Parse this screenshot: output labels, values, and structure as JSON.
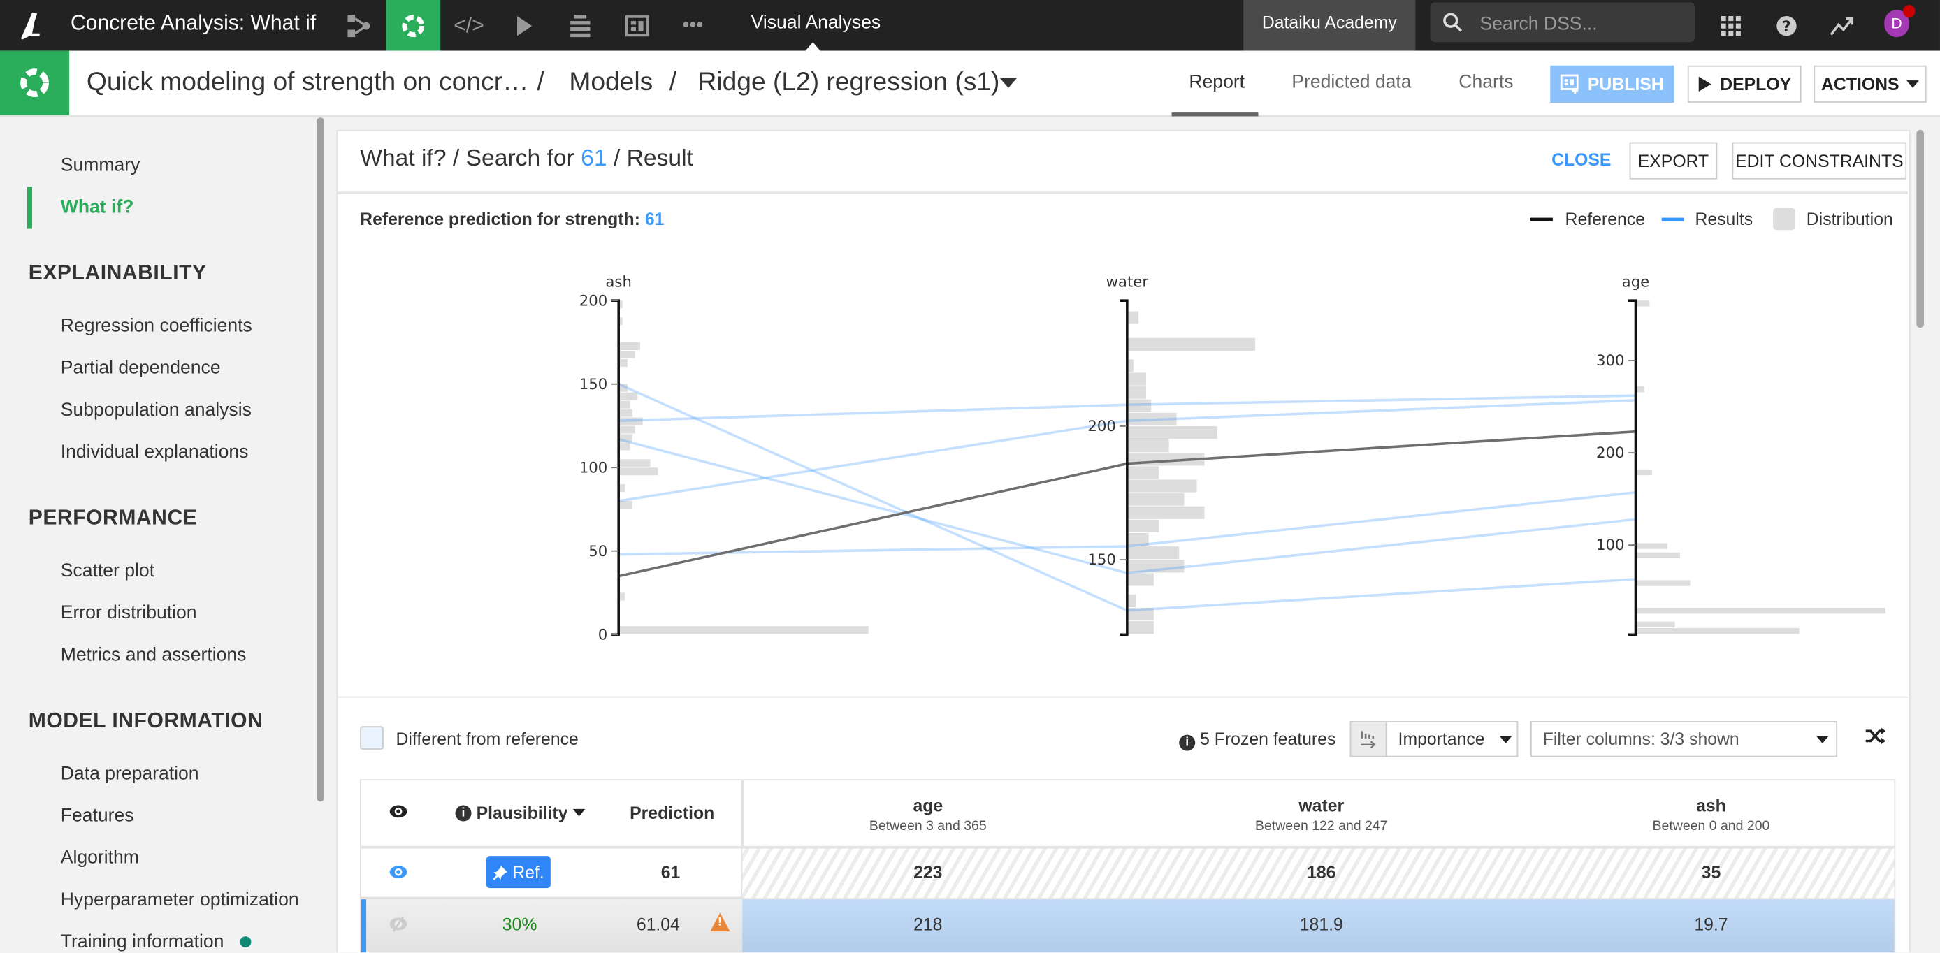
{
  "topbar": {
    "project_title": "Concrete Analysis: What if",
    "section_label": "Visual Analyses",
    "org_label": "Dataiku Academy",
    "search_placeholder": "Search DSS...",
    "avatar_initial": "D",
    "nav_icons": [
      "flow-icon",
      "lab-icon",
      "code-icon",
      "run-icon",
      "deployer-icon",
      "dashboard-icon",
      "more-icon"
    ],
    "accent": "#2aae5b"
  },
  "header": {
    "crumb_analysis": "Quick modeling of strength on concr…",
    "crumb_models": "Models",
    "crumb_model": "Ridge (L2) regression (s1)",
    "separator": "/",
    "tabs": [
      {
        "label": "Report",
        "active": true
      },
      {
        "label": "Predicted data",
        "active": false
      },
      {
        "label": "Charts",
        "active": false
      }
    ],
    "publish_label": "PUBLISH",
    "deploy_label": "DEPLOY",
    "actions_label": "ACTIONS"
  },
  "sidebar": {
    "top_items": [
      {
        "label": "Summary",
        "active": false
      },
      {
        "label": "What if?",
        "active": true
      }
    ],
    "sections": [
      {
        "title": "EXPLAINABILITY",
        "items": [
          "Regression coefficients",
          "Partial dependence",
          "Subpopulation analysis",
          "Individual explanations"
        ]
      },
      {
        "title": "PERFORMANCE",
        "items": [
          "Scatter plot",
          "Error distribution",
          "Metrics and assertions"
        ]
      },
      {
        "title": "MODEL INFORMATION",
        "items": [
          "Data preparation",
          "Features",
          "Algorithm",
          "Hyperparameter optimization",
          "Training information"
        ]
      }
    ]
  },
  "panel": {
    "title_prefix": "What if? / Search for ",
    "target_value": "61",
    "title_suffix": " / Result",
    "close_label": "CLOSE",
    "export_label": "EXPORT",
    "edit_constraints_label": "EDIT CONSTRAINTS",
    "ref_prediction_label": "Reference prediction for strength: ",
    "ref_prediction_value": "61"
  },
  "chart_data": {
    "type": "parallel-coordinates",
    "legend": [
      {
        "label": "Reference",
        "color": "#111111"
      },
      {
        "label": "Results",
        "color": "#3b99fc"
      },
      {
        "label": "Distribution",
        "color": "#dddddd"
      }
    ],
    "legend_position": "top-right",
    "axes": [
      {
        "name": "ash",
        "range": [
          0,
          200
        ],
        "ticks": [
          0,
          50,
          100,
          150,
          200
        ]
      },
      {
        "name": "water",
        "range": [
          122,
          247
        ],
        "ticks": [
          150,
          200
        ]
      },
      {
        "name": "age",
        "range": [
          3,
          365
        ],
        "ticks": [
          100,
          200,
          300
        ]
      }
    ],
    "reference": {
      "ash": 35,
      "water": 186,
      "age": 223
    },
    "results": [
      {
        "ash": 150,
        "water": 131,
        "age": 63
      },
      {
        "ash": 128,
        "water": 208,
        "age": 262
      },
      {
        "ash": 117,
        "water": 145,
        "age": 128
      },
      {
        "ash": 80,
        "water": 202,
        "age": 257
      },
      {
        "ash": 48,
        "water": 155,
        "age": 157
      }
    ],
    "distributions": {
      "ash": [
        [
          0,
          5,
          0.98
        ],
        [
          20,
          25,
          0.02
        ],
        [
          75,
          80,
          0.05
        ],
        [
          85,
          90,
          0.02
        ],
        [
          95,
          100,
          0.15
        ],
        [
          100,
          105,
          0.12
        ],
        [
          110,
          115,
          0.04
        ],
        [
          115,
          120,
          0.05
        ],
        [
          120,
          125,
          0.06
        ],
        [
          125,
          130,
          0.09
        ],
        [
          130,
          135,
          0.05
        ],
        [
          135,
          140,
          0.04
        ],
        [
          140,
          145,
          0.07
        ],
        [
          145,
          150,
          0.03
        ],
        [
          160,
          165,
          0.03
        ],
        [
          165,
          170,
          0.06
        ],
        [
          170,
          175,
          0.08
        ],
        [
          185,
          190,
          0.01
        ],
        [
          195,
          200,
          0.01
        ]
      ],
      "water": [
        [
          122,
          127,
          0.1
        ],
        [
          127,
          132,
          0.1
        ],
        [
          132,
          137,
          0.03
        ],
        [
          140,
          145,
          0.1
        ],
        [
          145,
          150,
          0.22
        ],
        [
          150,
          155,
          0.2
        ],
        [
          155,
          160,
          0.08
        ],
        [
          160,
          165,
          0.12
        ],
        [
          165,
          170,
          0.3
        ],
        [
          170,
          175,
          0.22
        ],
        [
          175,
          180,
          0.27
        ],
        [
          180,
          185,
          0.12
        ],
        [
          185,
          190,
          0.3
        ],
        [
          190,
          195,
          0.16
        ],
        [
          195,
          200,
          0.35
        ],
        [
          200,
          205,
          0.19
        ],
        [
          205,
          210,
          0.09
        ],
        [
          210,
          215,
          0.07
        ],
        [
          215,
          220,
          0.07
        ],
        [
          220,
          225,
          0.02
        ],
        [
          228,
          233,
          0.5
        ],
        [
          238,
          243,
          0.04
        ]
      ],
      "age": [
        [
          3,
          10,
          0.64
        ],
        [
          10,
          17,
          0.15
        ],
        [
          25,
          32,
          0.98
        ],
        [
          55,
          62,
          0.21
        ],
        [
          85,
          92,
          0.17
        ],
        [
          95,
          102,
          0.12
        ],
        [
          175,
          182,
          0.06
        ],
        [
          265,
          272,
          0.03
        ],
        [
          358,
          365,
          0.05
        ]
      ]
    }
  },
  "filters": {
    "different_from_reference_label": "Different from reference",
    "frozen_features_label": "5 Frozen features",
    "sort_by": "Importance",
    "filter_columns": "Filter columns: 3/3 shown"
  },
  "table": {
    "headers": {
      "plausibility": "Plausibility",
      "prediction": "Prediction"
    },
    "feature_columns": [
      {
        "name": "age",
        "range": "Between 3 and 365"
      },
      {
        "name": "water",
        "range": "Between 122 and 247"
      },
      {
        "name": "ash",
        "range": "Between 0 and 200"
      }
    ],
    "reference_row": {
      "badge": "Ref.",
      "prediction": "61",
      "age": "223",
      "water": "186",
      "ash": "35"
    },
    "rows": [
      {
        "plausibility": "30%",
        "prediction": "61.04",
        "age": "218",
        "water": "181.9",
        "ash": "19.7",
        "warning": true
      }
    ]
  }
}
